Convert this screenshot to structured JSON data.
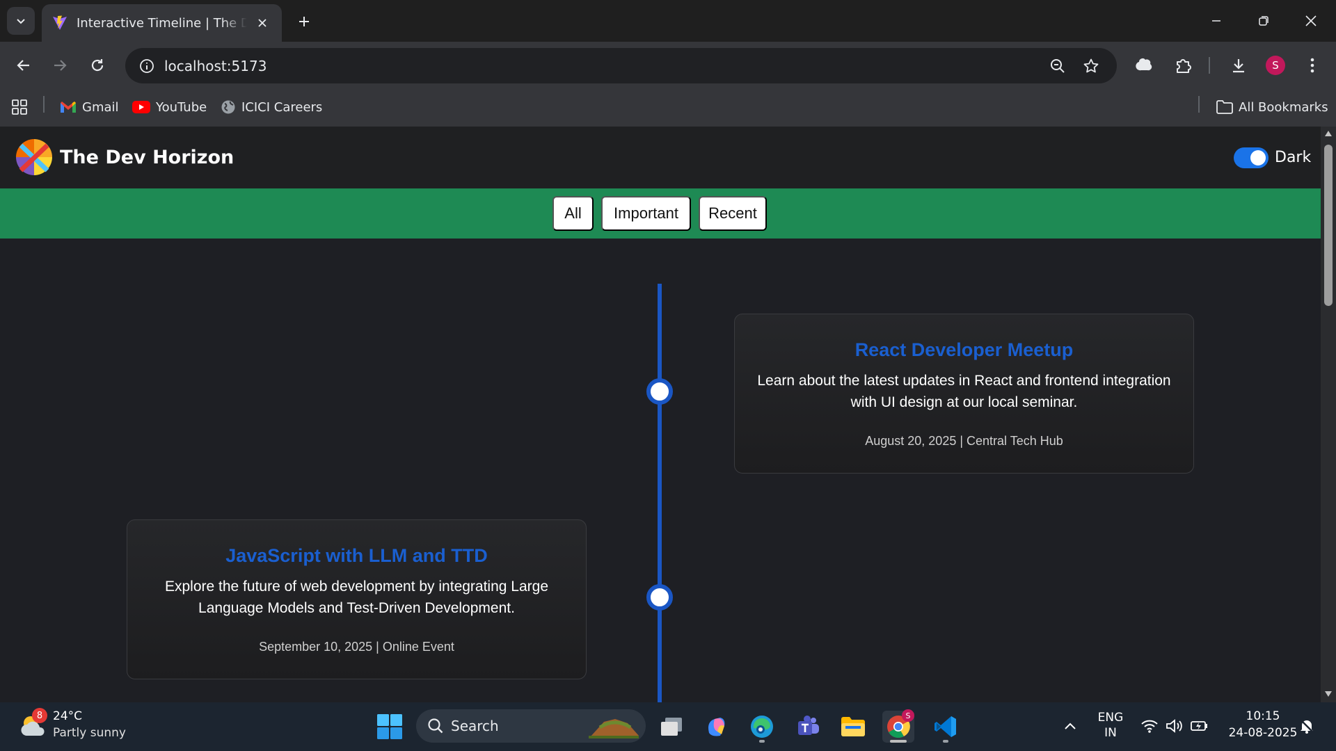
{
  "browser": {
    "tab": {
      "title": "Interactive Timeline | The Dev Horizon"
    },
    "address_bar": {
      "url": "localhost:5173"
    },
    "profile_initial": "S",
    "bookmarks": [
      {
        "label": "Gmail",
        "icon": "gmail-icon"
      },
      {
        "label": "YouTube",
        "icon": "youtube-icon"
      },
      {
        "label": "ICICI Careers",
        "icon": "globe-icon"
      }
    ],
    "all_bookmarks_label": "All Bookmarks"
  },
  "site": {
    "title": "The Dev Horizon",
    "theme_toggle": {
      "label": "Dark",
      "on": true
    },
    "filters": [
      "All",
      "Important",
      "Recent"
    ],
    "accent_color": "#1e8a54",
    "timeline_color": "#1a56c4",
    "events": [
      {
        "title": "React Developer Meetup",
        "description": "Learn about the latest updates in React and frontend integration with UI design at our local seminar.",
        "meta": "August 20, 2025 | Central Tech Hub",
        "side": "right"
      },
      {
        "title": "JavaScript with LLM and TTD",
        "description": "Explore the future of web development by integrating Large Language Models and Test-Driven Development.",
        "meta": "September 10, 2025 | Online Event",
        "side": "left"
      }
    ]
  },
  "taskbar": {
    "weather": {
      "temperature": "24°C",
      "condition": "Partly sunny",
      "badge": "8"
    },
    "search_label": "Search",
    "language": {
      "line1": "ENG",
      "line2": "IN"
    },
    "clock": {
      "time": "10:15",
      "date": "24-08-2025"
    },
    "chrome_badge": "S"
  }
}
